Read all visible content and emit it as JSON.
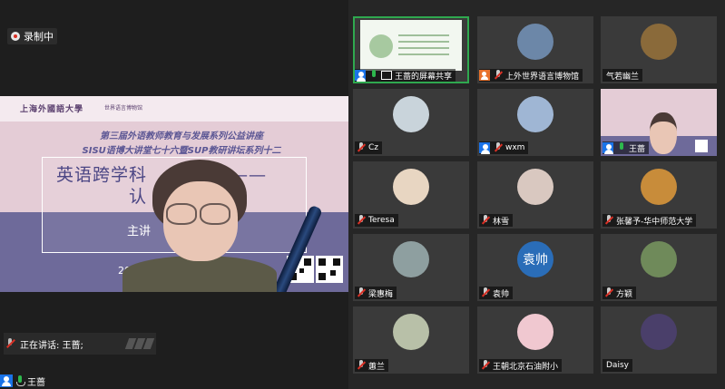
{
  "recording": {
    "label": "录制中"
  },
  "slide": {
    "logo": "上海外國語大學",
    "logo2": "世界语言博物馆",
    "line1": "第三届外语教师教育与发展系列公益讲座",
    "line2": "SISU语博大讲堂七十六暨SUP教研讲坛系列十二",
    "title1": "英语跨学科",
    "title1_tail": "学习——",
    "title2": "认",
    "presenter": "主讲",
    "date": "2024年 5"
  },
  "speaking": {
    "label": "正在讲话: 王蔷;"
  },
  "self": {
    "name": "王蔷"
  },
  "tiles": [
    {
      "name": "王蔷的屏幕共享",
      "type": "share",
      "icon": "person",
      "mic": "on"
    },
    {
      "name": "上外世界语言博物馆",
      "type": "photo",
      "icon": "orange-person",
      "mic": "off",
      "color": "#6c87a8"
    },
    {
      "name": "气若幽兰",
      "type": "photo",
      "icon": "none",
      "mic": "none",
      "color": "#8a6a3a"
    },
    {
      "name": "Cz",
      "type": "photo",
      "icon": "none",
      "mic": "off",
      "color": "#c9d4db"
    },
    {
      "name": "wxm",
      "type": "photo",
      "icon": "person",
      "mic": "off",
      "color": "#9fb6d4"
    },
    {
      "name": "王蔷",
      "type": "presenter",
      "icon": "person",
      "mic": "on"
    },
    {
      "name": "Teresa",
      "type": "photo",
      "icon": "none",
      "mic": "off",
      "color": "#e8d6c2"
    },
    {
      "name": "林雪",
      "type": "photo",
      "icon": "none",
      "mic": "off",
      "color": "#d9c8c0"
    },
    {
      "name": "张馨予-华中师范大学",
      "type": "photo",
      "icon": "none",
      "mic": "off",
      "color": "#c88c3a"
    },
    {
      "name": "梁惠梅",
      "type": "photo",
      "icon": "none",
      "mic": "off",
      "color": "#8e9fa0"
    },
    {
      "name": "袁帅",
      "type": "text",
      "text": "袁帅",
      "icon": "none",
      "mic": "off"
    },
    {
      "name": "方颖",
      "type": "photo",
      "icon": "none",
      "mic": "off",
      "color": "#6f8a5a"
    },
    {
      "name": "蕙兰",
      "type": "photo",
      "icon": "none",
      "mic": "off",
      "color": "#b8c0a8"
    },
    {
      "name": "王朝北京石油附小",
      "type": "photo",
      "icon": "none",
      "mic": "off",
      "color": "#f0c8d0"
    },
    {
      "name": "Daisy",
      "type": "photo",
      "icon": "none",
      "mic": "none",
      "color": "#4a3f6a"
    }
  ]
}
